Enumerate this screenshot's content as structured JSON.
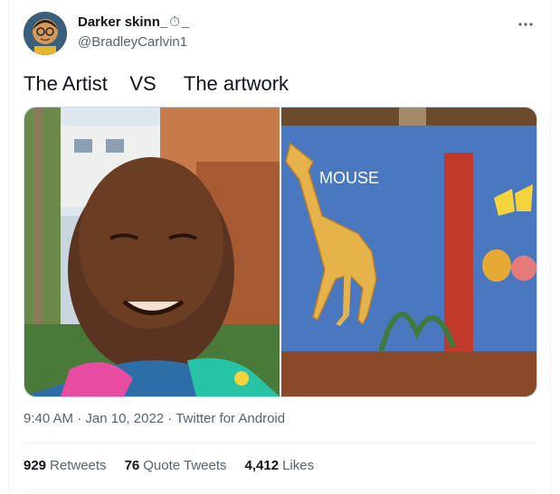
{
  "author": {
    "display_name": "Darker skinn_",
    "name_suffix_emoji": "⏱",
    "name_suffix_tail": "_",
    "handle": "@BradleyCarlvin1"
  },
  "tweet": {
    "text": "The Artist    VS     The artwork"
  },
  "media": {
    "left_photo": "selfie-photo",
    "right_photo": "wall-mural-photo",
    "mural_text": "MOUSE"
  },
  "meta": {
    "time": "9:40 AM",
    "sep1": " · ",
    "date": "Jan 10, 2022",
    "sep2": " · ",
    "source": "Twitter for Android"
  },
  "stats": {
    "retweets_count": "929",
    "retweets_label": "Retweets",
    "quotes_count": "76",
    "quotes_label": "Quote Tweets",
    "likes_count": "4,412",
    "likes_label": "Likes"
  },
  "colors": {
    "text_primary": "#0f1419",
    "text_secondary": "#536471",
    "border": "#eff3f4"
  },
  "icons": {
    "more": "more-horizontal-icon",
    "emoji": "stopwatch-icon"
  }
}
